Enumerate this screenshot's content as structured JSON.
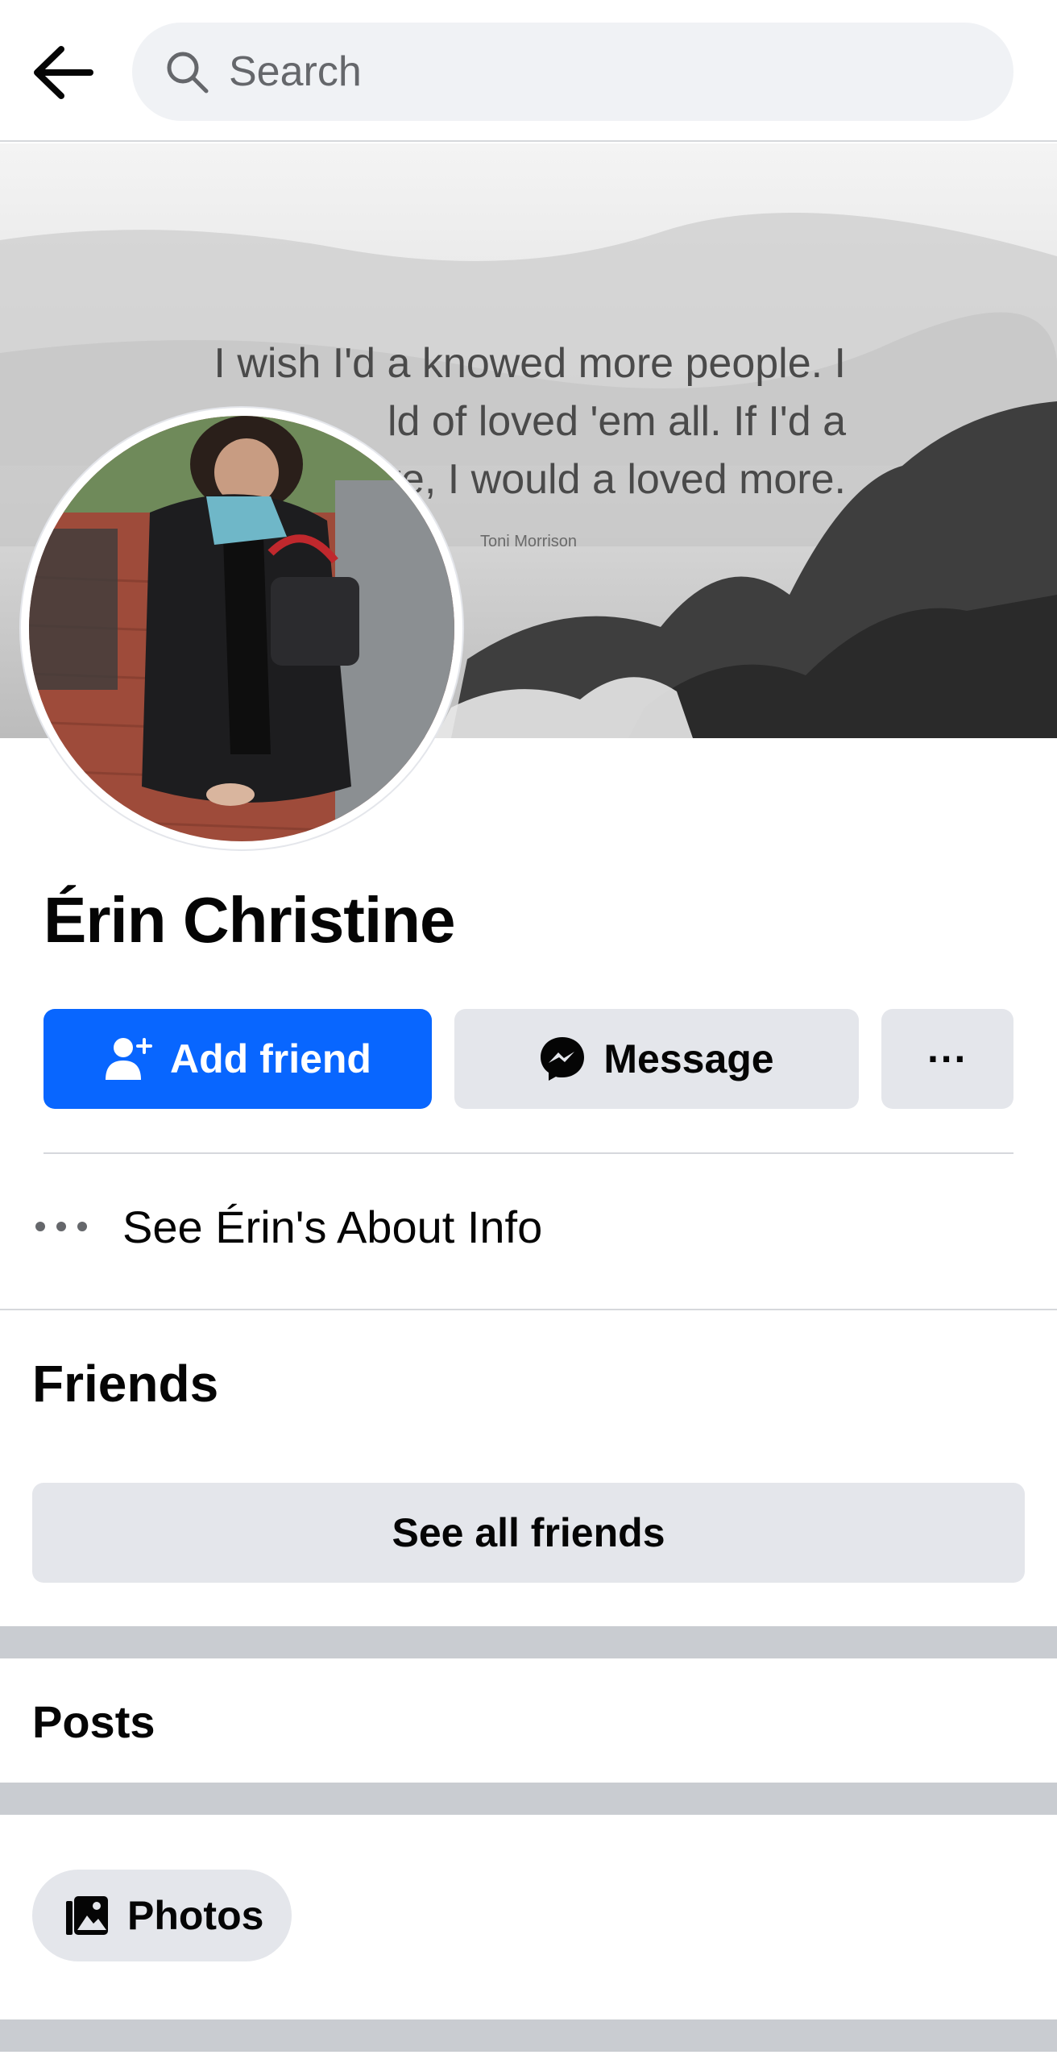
{
  "header": {
    "search_placeholder": "Search"
  },
  "cover": {
    "quote_line1": "I wish I'd a knowed more people. I",
    "quote_line2": "ld of loved 'em all. If I'd a",
    "quote_line3": "re, I would a loved more.",
    "quote_author": "Toni Morrison"
  },
  "profile": {
    "name": "Érin Christine"
  },
  "actions": {
    "add_friend": "Add friend",
    "message": "Message",
    "more": "···"
  },
  "about": {
    "label": "See Érin's About Info"
  },
  "friends": {
    "title": "Friends",
    "see_all": "See all friends"
  },
  "posts": {
    "title": "Posts"
  },
  "photos": {
    "label": "Photos"
  },
  "colors": {
    "primary_blue": "#0866ff",
    "button_gray": "#e4e6eb",
    "band_gray": "#c9ccd1"
  }
}
